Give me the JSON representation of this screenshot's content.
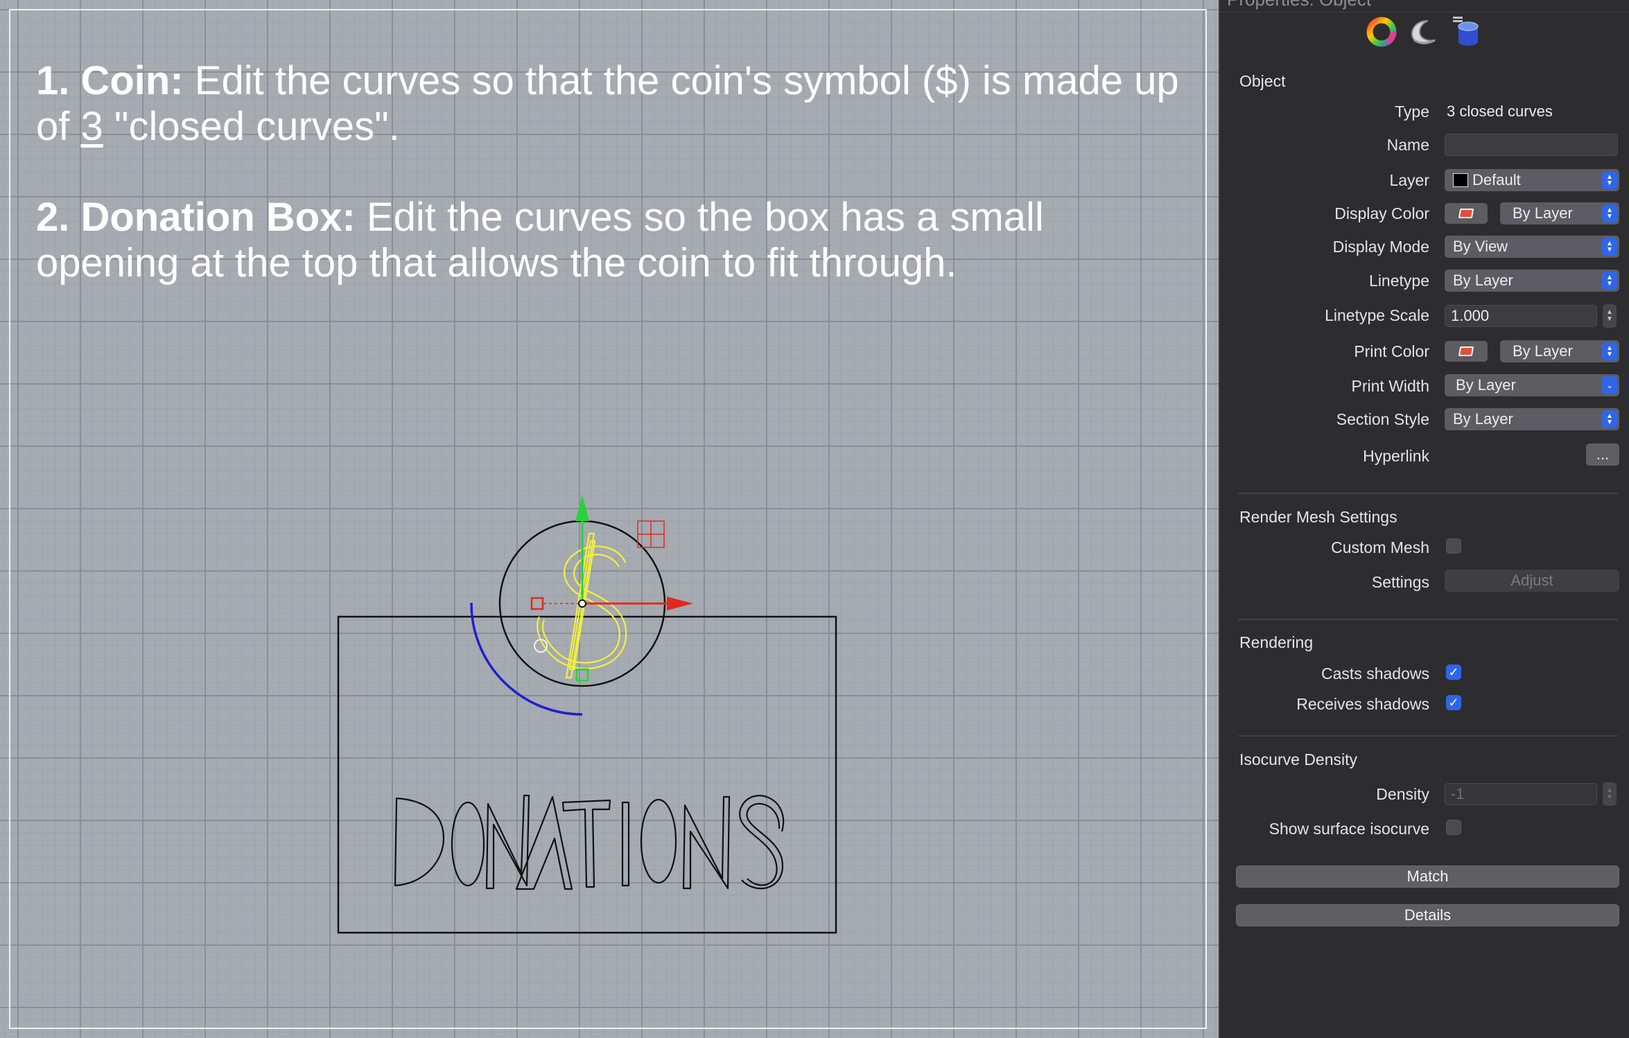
{
  "instructions": {
    "step1_title": "1. Coin:",
    "step1_text_a": "Edit the curves so that the coin's symbol ($) is made up of",
    "step1_number": "3",
    "step1_text_b": "\"closed curves\".",
    "step2_title": "2. Donation Box:",
    "step2_text": "Edit the curves so the box has a small opening at the top that allows the coin to fit through."
  },
  "scene": {
    "box_lettering": "DONATIONS",
    "coin_symbol": "$",
    "colors": {
      "curve": "#111111",
      "selected_curve": "#f2f23a",
      "partial_curve": "#1f1fcf",
      "gumball_x": "#e02a1e",
      "gumball_y": "#27d33a"
    }
  },
  "panel": {
    "title": "Properties: Object",
    "tabs": [
      "color-wheel-icon",
      "material-icon",
      "layer-cylinder-icon"
    ],
    "object_section": "Object",
    "rows": {
      "type_label": "Type",
      "type_value": "3 closed curves",
      "name_label": "Name",
      "name_value": "",
      "layer_label": "Layer",
      "layer_value": "Default",
      "display_color_label": "Display Color",
      "display_color_value": "By Layer",
      "display_mode_label": "Display Mode",
      "display_mode_value": "By View",
      "linetype_label": "Linetype",
      "linetype_value": "By Layer",
      "linetype_scale_label": "Linetype Scale",
      "linetype_scale_value": "1.000",
      "print_color_label": "Print Color",
      "print_color_value": "By Layer",
      "print_width_label": "Print Width",
      "print_width_value": "By Layer",
      "section_style_label": "Section Style",
      "section_style_value": "By Layer",
      "hyperlink_label": "Hyperlink",
      "hyperlink_button": "..."
    },
    "render_mesh": {
      "title": "Render Mesh Settings",
      "custom_mesh_label": "Custom Mesh",
      "custom_mesh_checked": false,
      "settings_label": "Settings",
      "adjust_button": "Adjust"
    },
    "rendering": {
      "title": "Rendering",
      "casts_label": "Casts shadows",
      "casts_checked": true,
      "receives_label": "Receives shadows",
      "receives_checked": true
    },
    "isocurve": {
      "title": "Isocurve Density",
      "density_label": "Density",
      "density_value": "-1",
      "show_label": "Show surface isocurve",
      "show_checked": false
    },
    "match_button": "Match",
    "details_button": "Details",
    "accent": "#2f66e8"
  }
}
